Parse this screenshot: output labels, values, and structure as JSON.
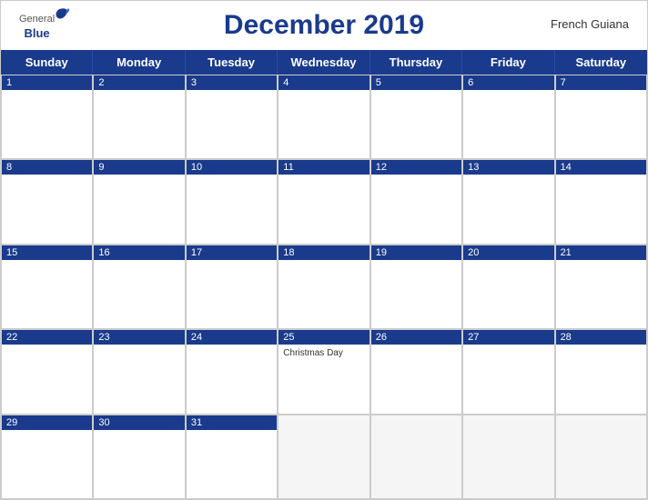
{
  "header": {
    "logo_general": "General",
    "logo_blue": "Blue",
    "title": "December 2019",
    "region": "French Guiana"
  },
  "days": [
    "Sunday",
    "Monday",
    "Tuesday",
    "Wednesday",
    "Thursday",
    "Friday",
    "Saturday"
  ],
  "weeks": [
    [
      {
        "date": "1",
        "events": []
      },
      {
        "date": "2",
        "events": []
      },
      {
        "date": "3",
        "events": []
      },
      {
        "date": "4",
        "events": []
      },
      {
        "date": "5",
        "events": []
      },
      {
        "date": "6",
        "events": []
      },
      {
        "date": "7",
        "events": []
      }
    ],
    [
      {
        "date": "8",
        "events": []
      },
      {
        "date": "9",
        "events": []
      },
      {
        "date": "10",
        "events": []
      },
      {
        "date": "11",
        "events": []
      },
      {
        "date": "12",
        "events": []
      },
      {
        "date": "13",
        "events": []
      },
      {
        "date": "14",
        "events": []
      }
    ],
    [
      {
        "date": "15",
        "events": []
      },
      {
        "date": "16",
        "events": []
      },
      {
        "date": "17",
        "events": []
      },
      {
        "date": "18",
        "events": []
      },
      {
        "date": "19",
        "events": []
      },
      {
        "date": "20",
        "events": []
      },
      {
        "date": "21",
        "events": []
      }
    ],
    [
      {
        "date": "22",
        "events": []
      },
      {
        "date": "23",
        "events": []
      },
      {
        "date": "24",
        "events": []
      },
      {
        "date": "25",
        "events": [
          "Christmas Day"
        ]
      },
      {
        "date": "26",
        "events": []
      },
      {
        "date": "27",
        "events": []
      },
      {
        "date": "28",
        "events": []
      }
    ],
    [
      {
        "date": "29",
        "events": []
      },
      {
        "date": "30",
        "events": []
      },
      {
        "date": "31",
        "events": []
      },
      {
        "date": "",
        "events": []
      },
      {
        "date": "",
        "events": []
      },
      {
        "date": "",
        "events": []
      },
      {
        "date": "",
        "events": []
      }
    ]
  ],
  "colors": {
    "header_bg": "#1a3a8c",
    "accent": "#1a3a8c"
  }
}
